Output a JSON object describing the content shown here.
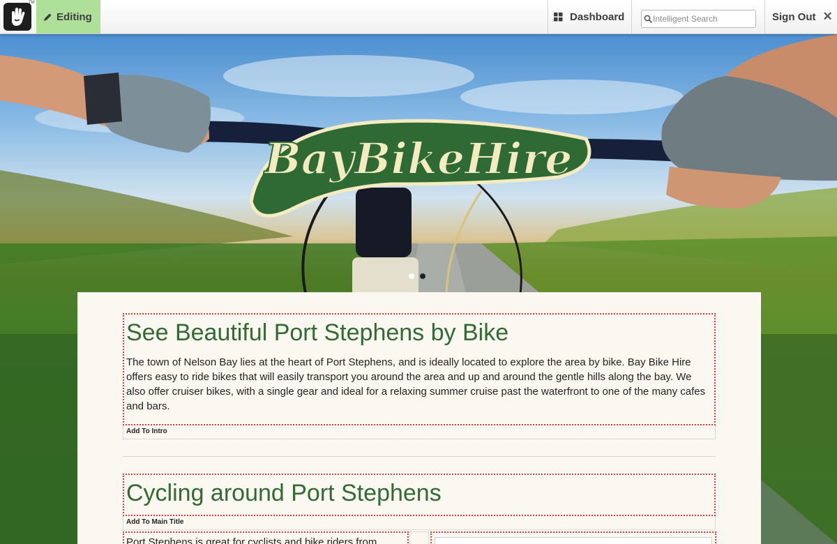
{
  "toolbar": {
    "editing_label": "Editing",
    "dashboard_label": "Dashboard",
    "search_placeholder": "Intelligent Search",
    "signout_label": "Sign Out",
    "logo_tm": "TM"
  },
  "hero": {
    "logo_text": "BayBikeHire"
  },
  "intro": {
    "heading": "See Beautiful Port Stephens by Bike",
    "body": "The town of Nelson Bay lies at the heart of Port Stephens, and is ideally located to explore the area by bike. Bay Bike Hire offers easy to ride bikes that will easily transport you around the area and up and around the gentle hills along the bay. We also offer cruiser bikes, with a single gear and ideal for a relaxing summer cruise past the waterfront to one of the many cafes and bars.",
    "add_label": "Add To Intro"
  },
  "main": {
    "heading": "Cycling around Port Stephens",
    "add_label": "Add To Main Title",
    "column_text": "Port Stephens is great for cyclists and bike riders from"
  },
  "colors": {
    "editing_bg": "#aee09a",
    "heading_green": "#336a34",
    "edit_border": "#e03a3a",
    "panel_bg": "#faf8f0",
    "logo_cream": "#f4ecc0",
    "logo_green": "#2f6a34"
  },
  "icons": [
    "concrete5-hand-icon",
    "pencil-icon",
    "dashboard-grid-icon",
    "search-icon",
    "close-icon"
  ]
}
